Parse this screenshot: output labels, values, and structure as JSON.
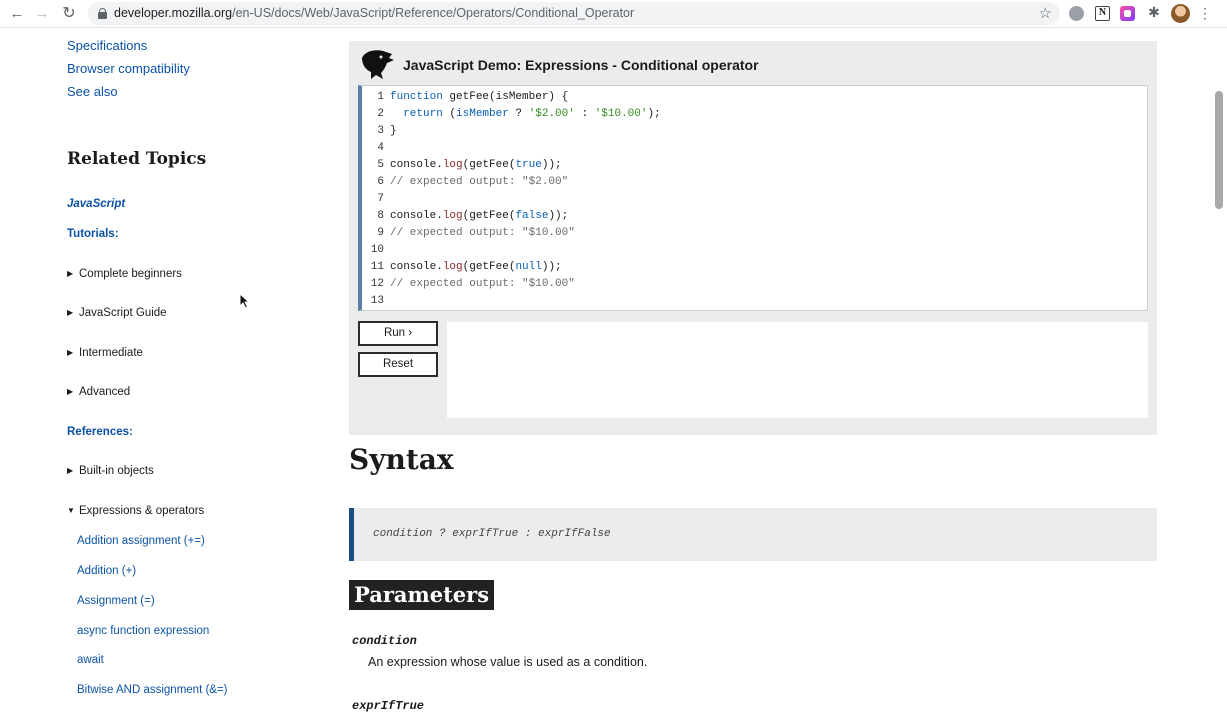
{
  "browser": {
    "url_host": "developer.mozilla.org",
    "url_path": "/en-US/docs/Web/JavaScript/Reference/Operators/Conditional_Operator",
    "extension_2_letter": "N"
  },
  "sidebar": {
    "toc_links": [
      "Specifications",
      "Browser compatibility",
      "See also"
    ],
    "related_title": "Related Topics",
    "javascript_link": "JavaScript",
    "tutorials_label": "Tutorials:",
    "tutorials": [
      "Complete beginners",
      "JavaScript Guide",
      "Intermediate",
      "Advanced"
    ],
    "references_label": "References:",
    "references": [
      "Built-in objects",
      "Expressions & operators"
    ],
    "operators": [
      "Addition assignment (+=)",
      "Addition (+)",
      "Assignment (=)",
      "async function expression",
      "await",
      "Bitwise AND assignment (&=)"
    ],
    "collapsed_glyph": "▶",
    "expanded_glyph": "▼"
  },
  "demo": {
    "title": "JavaScript Demo: Expressions - Conditional operator",
    "run_label": "Run ›",
    "reset_label": "Reset",
    "line_numbers": [
      "1",
      "2",
      "3",
      "4",
      "5",
      "6",
      "7",
      "8",
      "9",
      "10",
      "11",
      "12",
      "13"
    ],
    "code": {
      "l1_kw": "function",
      "l1_rest": " getFee(isMember) {",
      "l2_indent": "  ",
      "l2_kw": "return",
      "l2_a": " (",
      "l2_var": "isMember",
      "l2_b": " ? ",
      "l2_s1": "'$2.00'",
      "l2_c": " : ",
      "l2_s2": "'$10.00'",
      "l2_d": ");",
      "l3": "}",
      "l5_a": "console.",
      "l5_fn": "log",
      "l5_b": "(getFee(",
      "l5_kw": "true",
      "l5_c": "));",
      "l6": "// expected output: \"$2.00\"",
      "l8_a": "console.",
      "l8_fn": "log",
      "l8_b": "(getFee(",
      "l8_kw": "false",
      "l8_c": "));",
      "l9": "// expected output: \"$10.00\"",
      "l11_a": "console.",
      "l11_fn": "log",
      "l11_b": "(getFee(",
      "l11_kw": "null",
      "l11_c": "));",
      "l12": "// expected output: \"$10.00\""
    }
  },
  "content": {
    "syntax_heading": "Syntax",
    "syntax_code": "condition ? exprIfTrue : exprIfFalse",
    "parameters_heading": "Parameters",
    "param1_name": "condition",
    "param1_desc": "An expression whose value is used as a condition.",
    "param2_name": "exprIfTrue"
  },
  "colors": {
    "link": "#0b52a6",
    "editor_border": "#5b7fa6",
    "syntax_border": "#1b4e82",
    "keyword": "#0a5fb4",
    "string": "#358a21",
    "comment": "#6b6b6b"
  }
}
